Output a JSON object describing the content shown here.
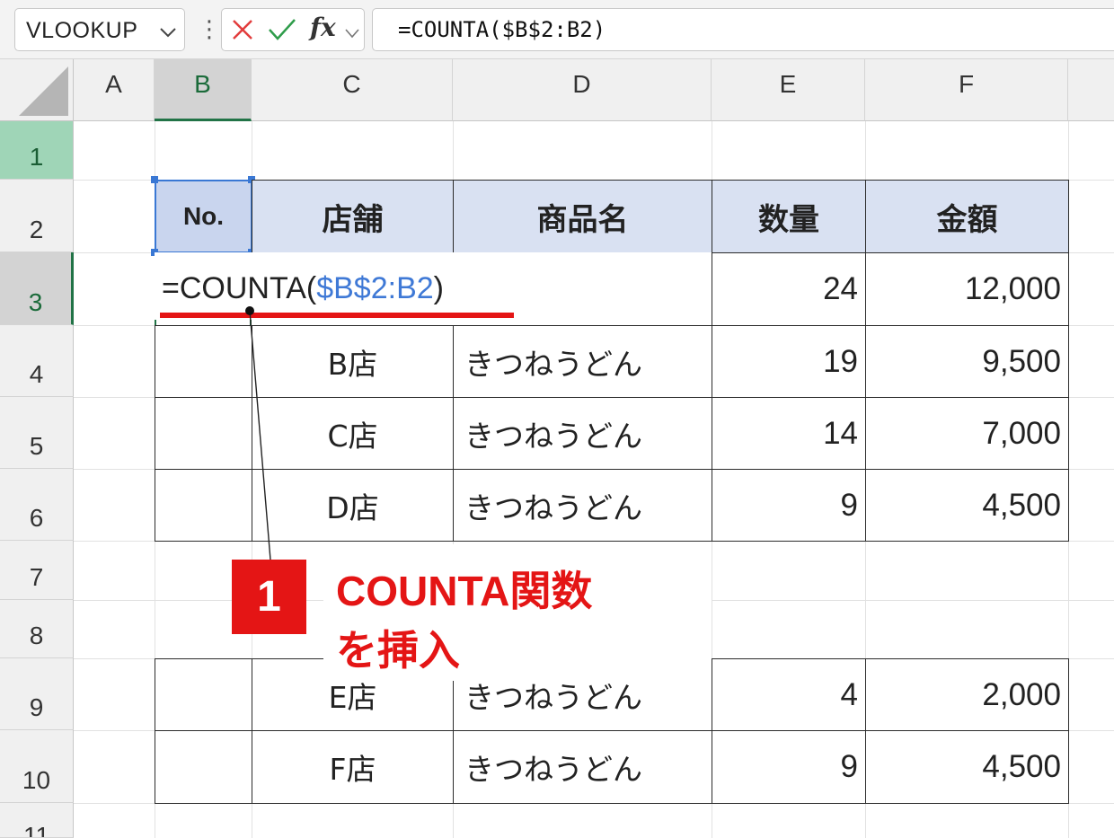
{
  "formula_bar": {
    "name_box": "VLOOKUP",
    "fx_label": "fx",
    "formula": "=COUNTA($B$2:B2)"
  },
  "columns": [
    "A",
    "B",
    "C",
    "D",
    "E",
    "F"
  ],
  "rows": [
    "1",
    "2",
    "3",
    "4",
    "5",
    "6",
    "7",
    "8",
    "9",
    "10",
    "11"
  ],
  "table": {
    "headers": [
      "No.",
      "店舗",
      "商品名",
      "数量",
      "金額"
    ],
    "row3": {
      "formula_prefix": "=COUNTA(",
      "formula_ref": "$B$2:B2",
      "formula_suffix": ")",
      "qty": "24",
      "amount": "12,000"
    },
    "rows": [
      {
        "store": "B店",
        "product": "きつねうどん",
        "qty": "19",
        "amount": "9,500"
      },
      {
        "store": "C店",
        "product": "きつねうどん",
        "qty": "14",
        "amount": "7,000"
      },
      {
        "store": "D店",
        "product": "きつねうどん",
        "qty": "9",
        "amount": "4,500"
      },
      {
        "store": "E店",
        "product": "きつねうどん",
        "qty": "4",
        "amount": "2,000"
      },
      {
        "store": "F店",
        "product": "きつねうどん",
        "qty": "9",
        "amount": "4,500"
      }
    ]
  },
  "callout": {
    "step": "1",
    "line1": "COUNTA関数",
    "line2": "を挿入"
  },
  "colors": {
    "accent_red": "#e41515",
    "header_fill": "#d9e1f2",
    "selection_green": "#217346",
    "reference_blue": "#3f79d6"
  }
}
